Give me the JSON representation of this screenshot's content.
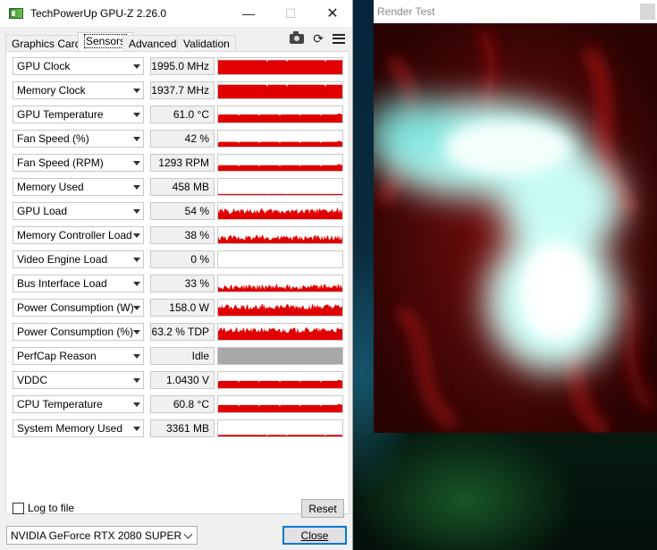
{
  "window": {
    "title": "TechPowerUp GPU-Z 2.26.0",
    "minimize_icon": "minimize-icon",
    "maximize_icon": "maximize-icon",
    "close_icon": "close-icon"
  },
  "tabs": [
    {
      "label": "Graphics Card",
      "active": false
    },
    {
      "label": "Sensors",
      "active": true
    },
    {
      "label": "Advanced",
      "active": false
    },
    {
      "label": "Validation",
      "active": false
    }
  ],
  "toolbar_icons": [
    "camera-icon",
    "refresh-icon",
    "menu-icon"
  ],
  "sensors": [
    {
      "label": "GPU Clock",
      "value": "1995.0 MHz",
      "level": 0.88,
      "noise": "flat"
    },
    {
      "label": "Memory Clock",
      "value": "1937.7 MHz",
      "level": 0.85,
      "noise": "flat"
    },
    {
      "label": "GPU Temperature",
      "value": "61.0 °C",
      "level": 0.5,
      "noise": "steps"
    },
    {
      "label": "Fan Speed (%)",
      "value": "42 %",
      "level": 0.3,
      "noise": "steps"
    },
    {
      "label": "Fan Speed (RPM)",
      "value": "1293 RPM",
      "level": 0.35,
      "noise": "steps"
    },
    {
      "label": "Memory Used",
      "value": "458 MB",
      "level": 0.06,
      "noise": "flat"
    },
    {
      "label": "GPU Load",
      "value": "54 %",
      "level": 0.5,
      "noise": "jagged"
    },
    {
      "label": "Memory Controller Load",
      "value": "38 %",
      "level": 0.35,
      "noise": "jagged"
    },
    {
      "label": "Video Engine Load",
      "value": "0 %",
      "level": 0,
      "noise": "flat"
    },
    {
      "label": "Bus Interface Load",
      "value": "33 %",
      "level": 0.3,
      "noise": "jagged"
    },
    {
      "label": "Power Consumption (W)",
      "value": "158.0 W",
      "level": 0.55,
      "noise": "jagged"
    },
    {
      "label": "Power Consumption (%)",
      "value": "63.2 % TDP",
      "level": 0.6,
      "noise": "jagged"
    },
    {
      "label": "PerfCap Reason",
      "value": "Idle",
      "level": 1,
      "noise": "gray"
    },
    {
      "label": "VDDC",
      "value": "1.0430 V",
      "level": 0.45,
      "noise": "steps"
    },
    {
      "label": "CPU Temperature",
      "value": "60.8 °C",
      "level": 0.45,
      "noise": "steps"
    },
    {
      "label": "System Memory Used",
      "value": "3361 MB",
      "level": 0.1,
      "noise": "flat"
    }
  ],
  "footer": {
    "log_to_file_label": "Log to file",
    "log_to_file_checked": false,
    "reset_label": "Reset",
    "gpu_selected": "NVIDIA GeForce RTX 2080 SUPER",
    "close_label": "Close"
  },
  "render_test": {
    "title": "Render Test"
  },
  "colors": {
    "graph_red": "#e00000",
    "graph_gray": "#a8a8a8",
    "accent_blue": "#0078d7"
  }
}
